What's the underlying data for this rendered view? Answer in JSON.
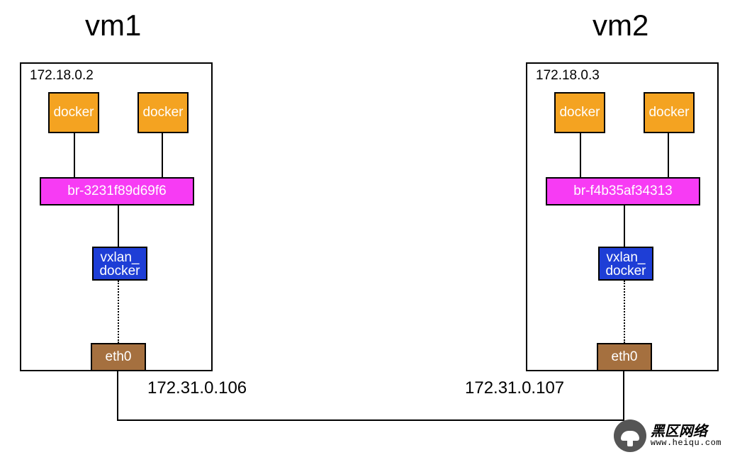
{
  "vm1": {
    "title": "vm1",
    "ip_overlay": "172.18.0.2",
    "docker_left": "docker",
    "docker_right": "docker",
    "bridge": "br-3231f89d69f6",
    "vxlan": "vxlan_\ndocker",
    "eth": "eth0",
    "ip_host": "172.31.0.106"
  },
  "vm2": {
    "title": "vm2",
    "ip_overlay": "172.18.0.3",
    "docker_left": "docker",
    "docker_right": "docker",
    "bridge": "br-f4b35af34313",
    "vxlan": "vxlan_\ndocker",
    "eth": "eth0",
    "ip_host": "172.31.0.107"
  },
  "watermark": {
    "cn": "黑区网络",
    "url": "www.heiqu.com"
  }
}
